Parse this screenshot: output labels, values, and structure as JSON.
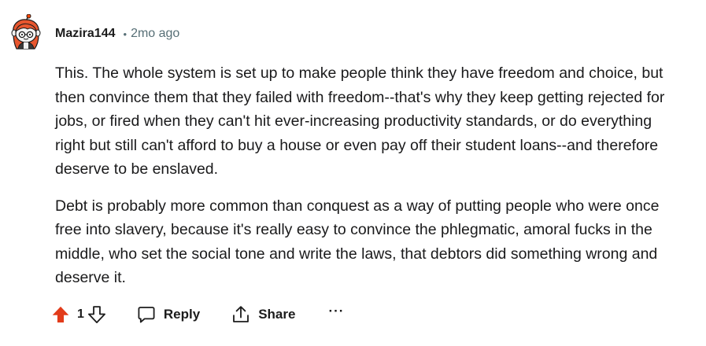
{
  "comment": {
    "author": "Mazira144",
    "separator": "•",
    "time_ago": "2mo ago",
    "paragraphs": [
      "This. The whole system is set up to make people think they have freedom and choice, but then convince them that they failed with freedom--that's why they keep getting rejected for jobs, or fired when they can't hit ever-increasing productivity standards, or do everything right but still can't afford to buy a house or even pay off their student loans--and therefore deserve to be enslaved.",
      "Debt is probably more common than conquest as a way of putting people who were once free into slavery, because it's really easy to convince the phlegmatic, amoral fucks in the middle, who set the social tone and write the laws, that debtors did something wrong and deserve it."
    ]
  },
  "actions": {
    "score": "1",
    "upvote_state": "upvoted",
    "reply_label": "Reply",
    "share_label": "Share",
    "more_label": "···"
  },
  "icons": {
    "upvote": "arrow-up-filled-icon",
    "downvote": "arrow-down-outline-icon",
    "reply": "speech-bubble-icon",
    "share": "share-upload-icon",
    "more": "ellipsis-icon"
  },
  "colors": {
    "upvote_active": "#e23b1a",
    "meta_text": "#576f76",
    "body_text": "#1a1a1b"
  }
}
